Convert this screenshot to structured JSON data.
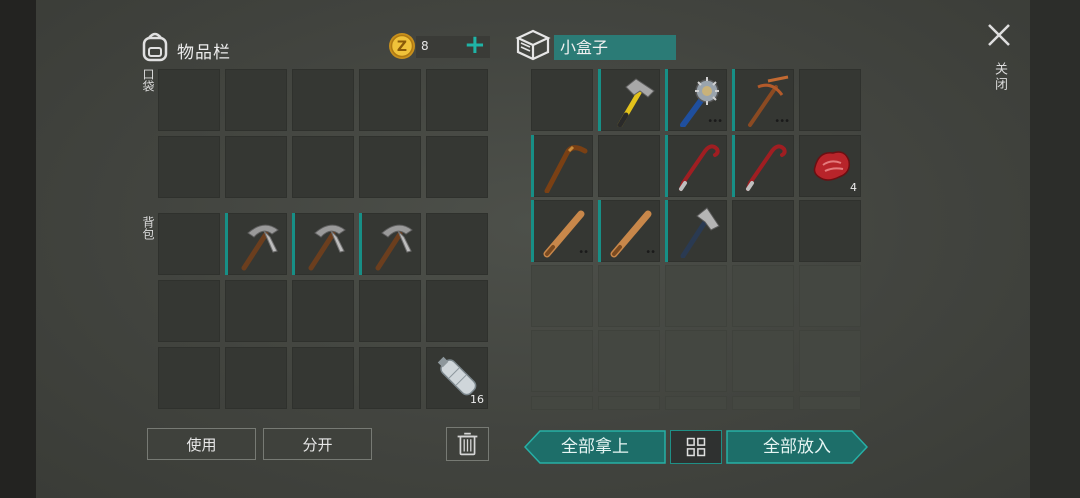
{
  "inventory": {
    "title": "物品栏",
    "coin_count": "8",
    "pocket_label": "口袋",
    "backpack_label": "背包",
    "bottle_qty": "16"
  },
  "container": {
    "name": "小盒子",
    "meat_qty": "4"
  },
  "close_label": "关闭",
  "buttons": {
    "use": "使用",
    "split": "分开",
    "take_all": "全部拿上",
    "put_all": "全部放入"
  },
  "colors": {
    "accent": "#1fb3a6",
    "slot": "#353733",
    "panel": "#42443f"
  }
}
